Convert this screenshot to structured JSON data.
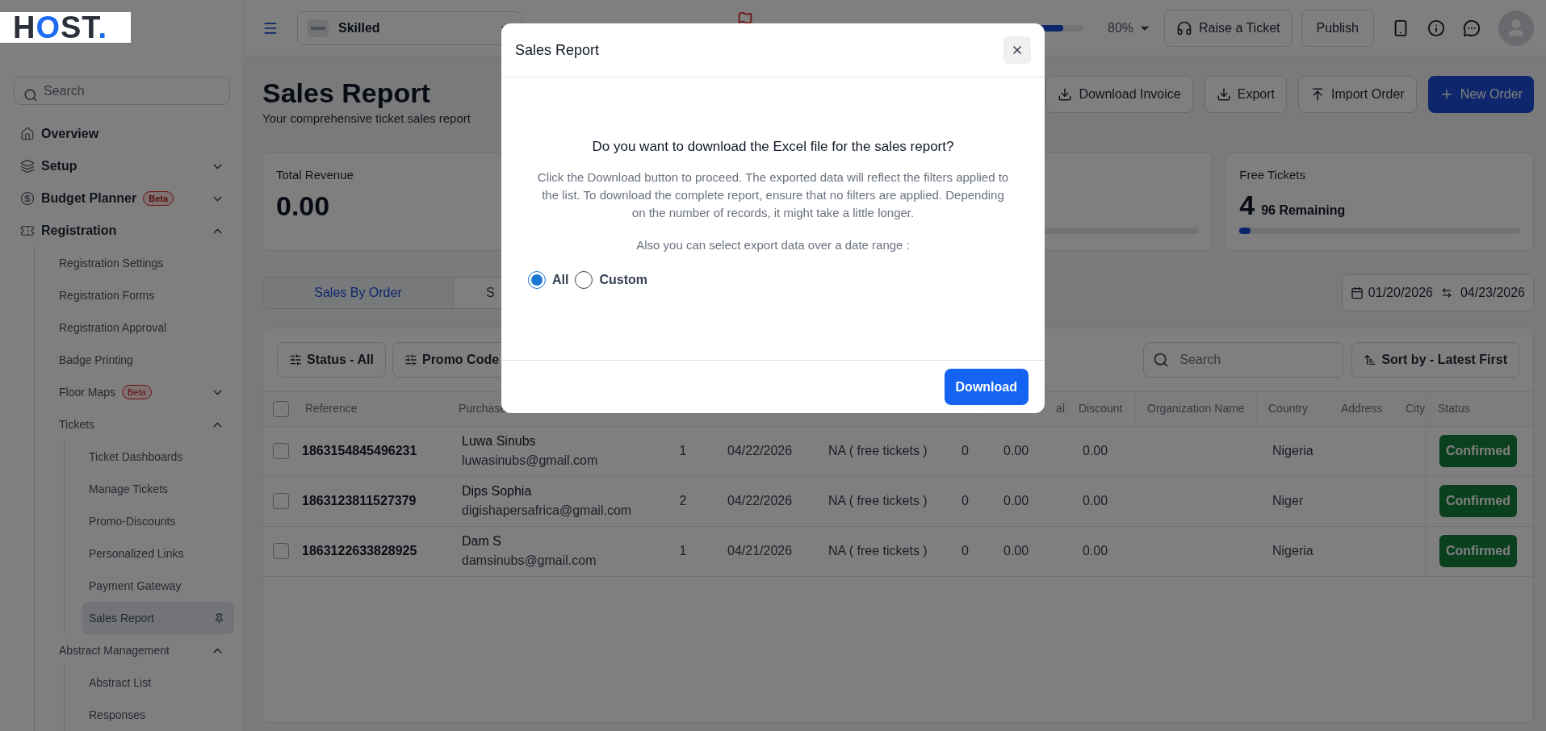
{
  "logo": [
    {
      "text": "H",
      "color": "#2b303b"
    },
    {
      "text": "O",
      "color": "#1d6cf2"
    },
    {
      "text": "ST",
      "color": "#2b303b"
    },
    {
      "text": ".",
      "color": "#1d6cf2"
    }
  ],
  "sidebar": {
    "search": {
      "placeholder": "Search"
    },
    "items": [
      {
        "label": "Overview",
        "selected": false
      },
      {
        "label": "Setup",
        "selected": false,
        "expanded": false
      },
      {
        "label": "Budget Planner",
        "badge": "Beta",
        "selected": false,
        "expanded": false
      },
      {
        "label": "Registration",
        "selected": false,
        "expanded": true,
        "children": [
          {
            "label": "Registration Settings",
            "selected": false
          },
          {
            "label": "Registration Forms",
            "selected": false
          },
          {
            "label": "Registration Approval",
            "selected": false
          },
          {
            "label": "Badge Printing",
            "selected": false
          },
          {
            "label": "Floor Maps",
            "badge": "Beta",
            "selected": false,
            "expanded": false
          },
          {
            "label": "Tickets",
            "selected": false,
            "expanded": true,
            "children": [
              {
                "label": "Ticket Dashboards",
                "selected": false
              },
              {
                "label": "Manage Tickets",
                "selected": false
              },
              {
                "label": "Promo-Discounts",
                "selected": false
              },
              {
                "label": "Personalized Links",
                "selected": false
              },
              {
                "label": "Payment Gateway",
                "selected": false
              },
              {
                "label": "Sales Report",
                "selected": true,
                "pinned": true
              }
            ]
          },
          {
            "label": "Abstract Management",
            "selected": false,
            "expanded": true,
            "children": [
              {
                "label": "Abstract List",
                "selected": false
              },
              {
                "label": "Responses",
                "selected": false
              }
            ]
          }
        ]
      }
    ]
  },
  "topbar": {
    "event": "Skilled",
    "progress": {
      "level": 0.8,
      "reading": "80%"
    },
    "buttons": [
      "Raise a Ticket",
      "Publish"
    ]
  },
  "header": {
    "title": "Sales Report",
    "subtitle": "Your comprehensive ticket sales report",
    "actions": [
      {
        "label": "Download Invoice",
        "kind": "download"
      },
      {
        "label": "Export",
        "kind": "export"
      },
      {
        "label": "Import Order",
        "kind": "import"
      },
      {
        "label": "New Order",
        "kind": "primary"
      }
    ]
  },
  "stats": {
    "revenue": {
      "label": "Total Revenue",
      "value": "0.00"
    },
    "free_tickets": {
      "label": "Free Tickets",
      "value": "4",
      "remaining": "96 Remaining",
      "level": 0.04
    }
  },
  "tabs": [
    {
      "label": "Sales By Order",
      "selected": true
    },
    {
      "label": "S",
      "selected": false
    }
  ],
  "date_range": {
    "start": "01/20/2026",
    "end": "04/23/2026"
  },
  "filters": [
    "Status - All",
    "Promo Code"
  ],
  "search": {
    "placeholder": "Search"
  },
  "sort": "Sort by - Latest First",
  "table": {
    "header_checked": false,
    "header_left": [
      "Reference",
      "Purchase"
    ],
    "header_right": [
      "al",
      "Discount",
      "Organization Name",
      "Country",
      "Address",
      "City",
      "Status"
    ],
    "rows": [
      {
        "checked": false,
        "reference": "1863154845496231",
        "name": "Luwa Sinubs",
        "email": "luwasinubs@gmail.com",
        "quantity": "1",
        "date": "04/22/2026",
        "ticket_type": "NA ( free tickets )",
        "column_6": "0",
        "column_7": "0.00",
        "discount": "0.00",
        "country": "Nigeria",
        "status": "Confirmed"
      },
      {
        "checked": false,
        "reference": "1863123811527379",
        "name": "Dips Sophia",
        "email": "digishapersafrica@gmail.com",
        "quantity": "2",
        "date": "04/22/2026",
        "ticket_type": "NA ( free tickets )",
        "column_6": "0",
        "column_7": "0.00",
        "discount": "0.00",
        "country": "Niger",
        "status": "Confirmed"
      },
      {
        "checked": false,
        "reference": "1863122633828925",
        "name": "Dam S",
        "email": "damsinubs@gmail.com",
        "quantity": "1",
        "date": "04/21/2026",
        "ticket_type": "NA ( free tickets )",
        "column_6": "0",
        "column_7": "0.00",
        "discount": "0.00",
        "country": "Nigeria",
        "status": "Confirmed"
      }
    ]
  },
  "modal": {
    "title": "Sales Report",
    "question": "Do you want to download the Excel file for the sales report?",
    "description": "Click the Download button to proceed. The exported data will reflect the filters applied to the list. To download the complete report, ensure that no filters are applied. Depending on the number of records, it might take a little longer.",
    "range_prompt": "Also you can select export data over a date range :",
    "options": [
      {
        "label": "All",
        "selected": true
      },
      {
        "label": "Custom",
        "selected": false
      }
    ],
    "button": "Download"
  }
}
